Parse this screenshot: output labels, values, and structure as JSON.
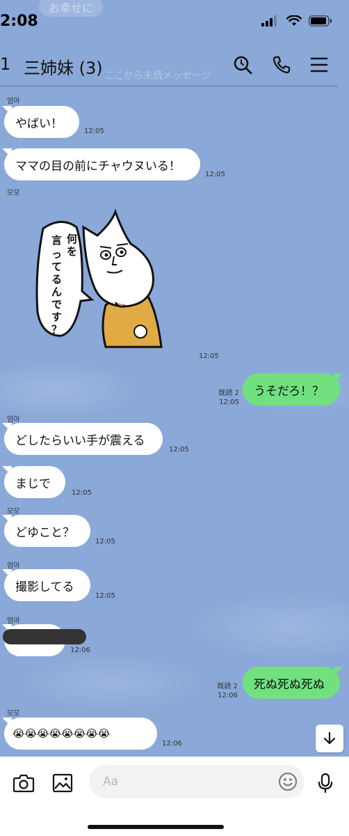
{
  "status_bar": {
    "time": "2:08",
    "ghost_notice": "お幸せに"
  },
  "header": {
    "back_count": "1",
    "title": "三姉妹 (3)",
    "ghost_text": "ここから未読メッセージ"
  },
  "messages": [
    {
      "sender": "엄마",
      "text": "やばい！",
      "time": "12:05"
    },
    {
      "text": "ママの目の前にチャウヌいる！",
      "time": "12:05"
    },
    {
      "sender": "모모",
      "sticker_text": "何を言ってるんですか？",
      "time": "12:05"
    },
    {
      "text": "うそだろ！？",
      "read": "既読 2",
      "time": "12:05"
    },
    {
      "sender": "엄마",
      "text": "どしたらいい手が震える",
      "time": "12:05"
    },
    {
      "text": "まじで",
      "time": "12:05"
    },
    {
      "sender": "모모",
      "text": "どゆこと？",
      "time": "12:05"
    },
    {
      "sender": "엄마",
      "text": "撮影してる",
      "time": "12:05"
    },
    {
      "sender": "엄마",
      "text": "",
      "time": "12:06"
    },
    {
      "text": "死ぬ死ぬ死ぬ",
      "read": "既読 2",
      "time": "12:06"
    },
    {
      "sender": "모모",
      "text": "😭😭😭😭😭😭😭😭",
      "time": "12:06"
    }
  ],
  "input": {
    "placeholder": "Aa"
  },
  "icons": {
    "search": "search-icon",
    "call": "phone-icon",
    "menu": "menu-icon",
    "camera": "camera-icon",
    "image": "image-icon",
    "emoji": "emoji-icon",
    "mic": "mic-icon",
    "scroll_down": "arrow-down-icon"
  },
  "colors": {
    "background": "#8aa8d8",
    "outgoing_bubble": "#71e07f",
    "incoming_bubble": "#ffffff"
  }
}
